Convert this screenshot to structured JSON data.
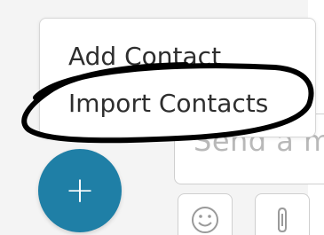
{
  "menu": {
    "items": [
      {
        "label": "Add Contact"
      },
      {
        "label": "Import Contacts"
      }
    ]
  },
  "composer": {
    "placeholder": "Send a m"
  },
  "fab": {
    "label": "+"
  },
  "icons": {
    "fab": "plus-icon",
    "emoji": "smiley-icon",
    "attach": "paperclip-icon"
  },
  "colors": {
    "fab": "#1f7fa6",
    "annotation": "#000000"
  }
}
